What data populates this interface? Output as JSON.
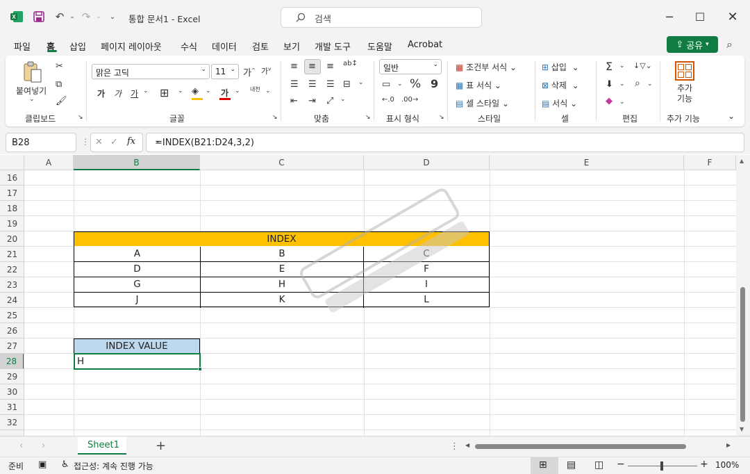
{
  "app": {
    "title": "통합 문서1  -  Excel",
    "search_placeholder": "검색",
    "share_label": "공유"
  },
  "tabs": [
    "파일",
    "홈",
    "삽입",
    "페이지 레이아웃",
    "수식",
    "데이터",
    "검토",
    "보기",
    "개발 도구",
    "도움말",
    "Acrobat"
  ],
  "ribbon": {
    "groups": {
      "clipboard": "클립보드",
      "font": "글꼴",
      "alignment": "맞춤",
      "number": "표시 형식",
      "styles": "스타일",
      "cells": "셀",
      "editing": "편집",
      "addins": "추가 기능"
    },
    "paste_label": "붙여넣기",
    "font_name": "맑은 고딕",
    "font_size": "11",
    "number_format": "일반",
    "conditional_format": "조건부 서식",
    "format_table": "표 서식",
    "cell_styles": "셀 스타일",
    "insert": "삽입",
    "delete": "삭제",
    "format": "서식",
    "addins_btn": "추가 기능",
    "bold": "가",
    "italic": "가",
    "underline": "가",
    "font_grow": "가",
    "font_shrink": "가",
    "font_color_glyph": "가",
    "phonetic": "내천",
    "percent": "%",
    "comma": "9"
  },
  "formula_bar": {
    "name_box": "B28",
    "formula": "=INDEX(B21:D24,3,2)"
  },
  "columns": [
    "A",
    "B",
    "C",
    "D",
    "E",
    "F"
  ],
  "rows": [
    "16",
    "17",
    "18",
    "19",
    "20",
    "21",
    "22",
    "23",
    "24",
    "25",
    "26",
    "27",
    "28",
    "29",
    "30",
    "31",
    "32"
  ],
  "table": {
    "header": "INDEX",
    "rows": [
      [
        "A",
        "B",
        "C"
      ],
      [
        "D",
        "E",
        "F"
      ],
      [
        "G",
        "H",
        "I"
      ],
      [
        "J",
        "K",
        "L"
      ]
    ]
  },
  "result": {
    "label": "INDEX VALUE",
    "value": "H"
  },
  "sheet_tab": "Sheet1",
  "status": {
    "ready": "준비",
    "accessibility": "접근성: 계속 진행 가능",
    "zoom": "100%"
  },
  "colors": {
    "excel_green": "#107c41",
    "header_fill": "#ffc000",
    "result_label_fill": "#bdd7ee"
  }
}
